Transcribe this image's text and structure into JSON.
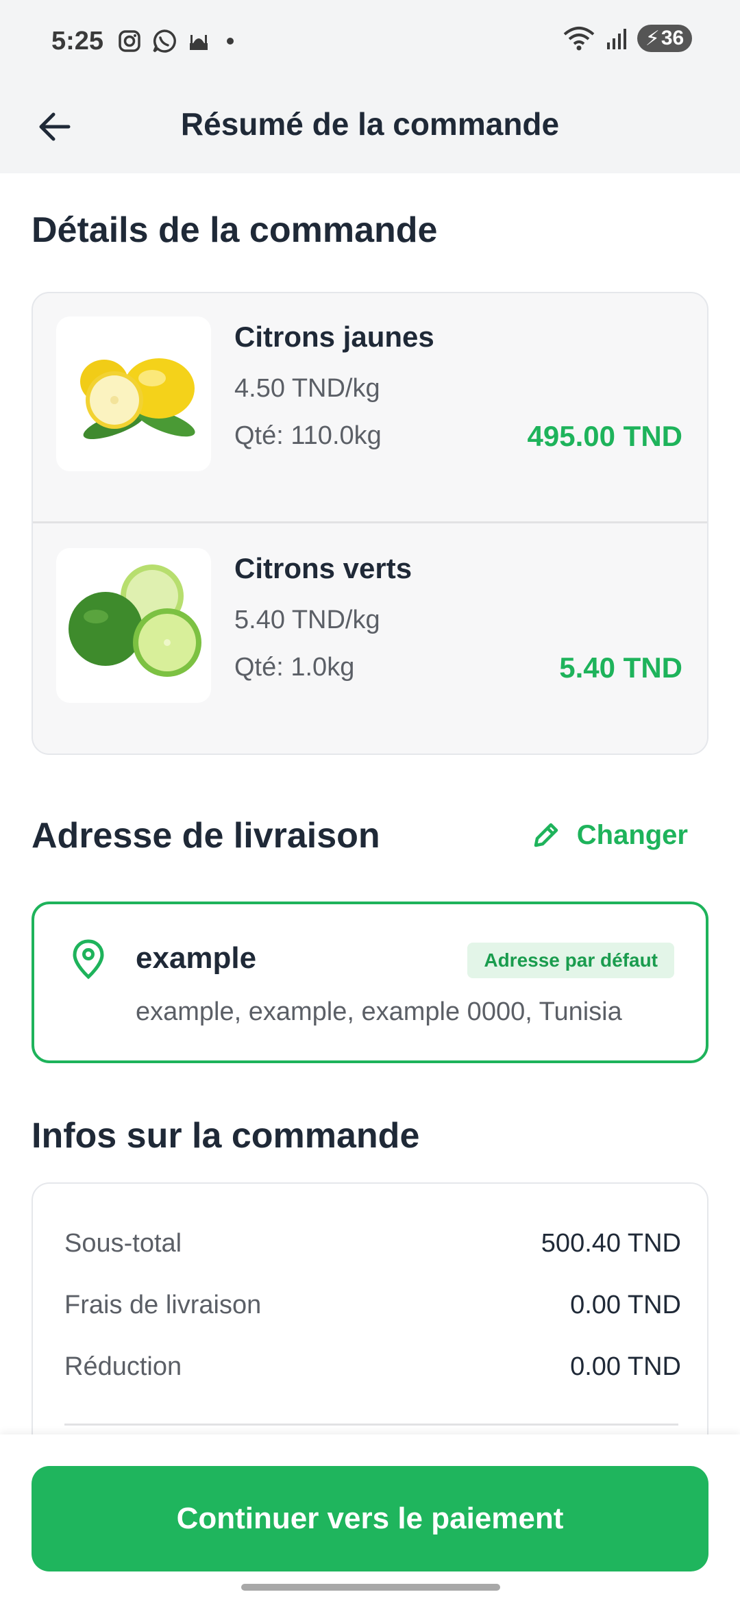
{
  "status_bar": {
    "time": "5:25",
    "left_icons": [
      "instagram-icon",
      "whatsapp-icon",
      "mosque-icon",
      "dot-icon"
    ],
    "right_icons": [
      "wifi-icon",
      "signal-icon"
    ],
    "battery_level": "36"
  },
  "app_bar": {
    "title": "Résumé de la commande"
  },
  "order_details": {
    "section_title": "Détails de la commande",
    "items": [
      {
        "name": "Citrons jaunes",
        "unit_price": "4.50 TND/kg",
        "quantity": "Qté: 110.0kg",
        "total": "495.00 TND"
      },
      {
        "name": "Citrons verts",
        "unit_price": "5.40 TND/kg",
        "quantity": "Qté: 1.0kg",
        "total": "5.40 TND"
      }
    ]
  },
  "delivery_address": {
    "section_title": "Adresse de livraison",
    "change_label": "Changer",
    "name": "example",
    "badge": "Adresse par défaut",
    "address_line": "example, example, example 0000, Tunisia"
  },
  "order_info": {
    "section_title": "Infos sur la commande",
    "rows": [
      {
        "label": "Sous-total",
        "value": "500.40 TND"
      },
      {
        "label": "Frais de livraison",
        "value": "0.00 TND"
      },
      {
        "label": "Réduction",
        "value": "0.00 TND"
      }
    ]
  },
  "cta": {
    "label": "Continuer vers le paiement"
  },
  "colors": {
    "accent": "#1eb35b",
    "badge_bg": "#e3f5e8",
    "header_bg": "#f3f4f5"
  }
}
